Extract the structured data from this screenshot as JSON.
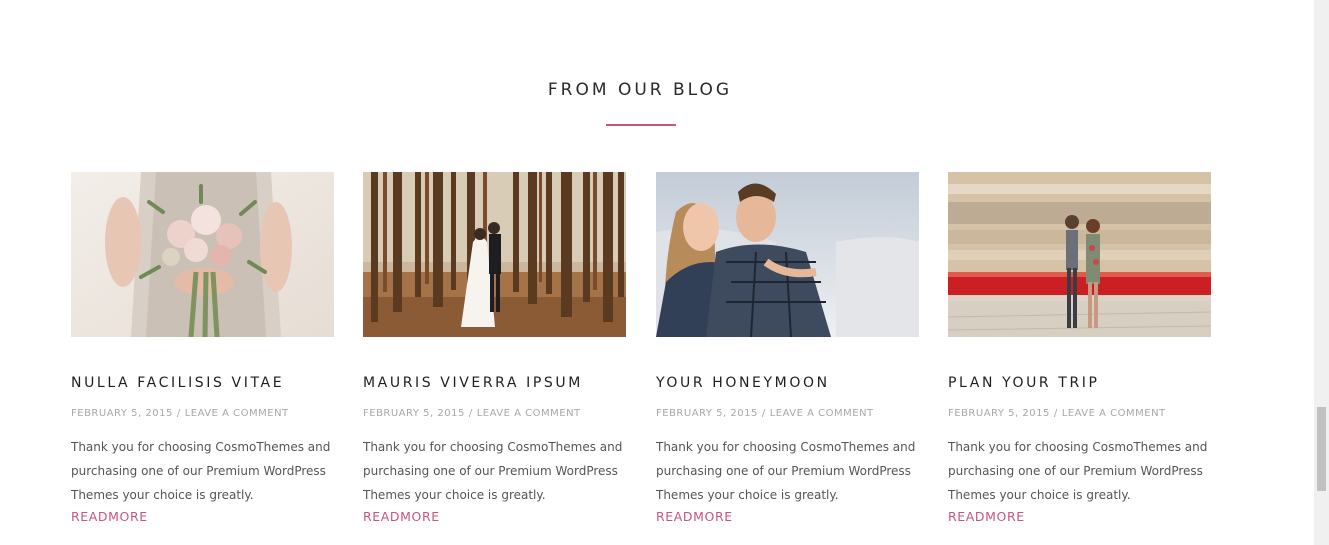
{
  "section": {
    "title": "FROM OUR BLOG",
    "accent_color": "#c9567a"
  },
  "posts": [
    {
      "title": "NULLA FACILISIS VITAE",
      "date": "FEBRUARY 5, 2015",
      "separator": "/",
      "comment_link": "LEAVE A COMMENT",
      "excerpt": "Thank you for choosing CosmoThemes and purchasing one of our Premium WordPress Themes your choice is greatly.",
      "readmore": "READMORE",
      "image": "bride-bouquet-image"
    },
    {
      "title": "MAURIS VIVERRA IPSUM",
      "date": "FEBRUARY 5, 2015",
      "separator": "/",
      "comment_link": "LEAVE A COMMENT",
      "excerpt": "Thank you for choosing CosmoThemes and purchasing one of our Premium WordPress Themes your choice is greatly.",
      "readmore": "READMORE",
      "image": "forest-couple-image"
    },
    {
      "title": "YOUR HONEYMOON",
      "date": "FEBRUARY 5, 2015",
      "separator": "/",
      "comment_link": "LEAVE A COMMENT",
      "excerpt": "Thank you for choosing CosmoThemes and purchasing one of our Premium WordPress Themes your choice is greatly.",
      "readmore": "READMORE",
      "image": "embracing-couple-image"
    },
    {
      "title": "PLAN YOUR TRIP",
      "date": "FEBRUARY 5, 2015",
      "separator": "/",
      "comment_link": "LEAVE A COMMENT",
      "excerpt": "Thank you for choosing CosmoThemes and purchasing one of our Premium WordPress Themes your choice is greatly.",
      "readmore": "READMORE",
      "image": "train-station-couple-image"
    }
  ]
}
